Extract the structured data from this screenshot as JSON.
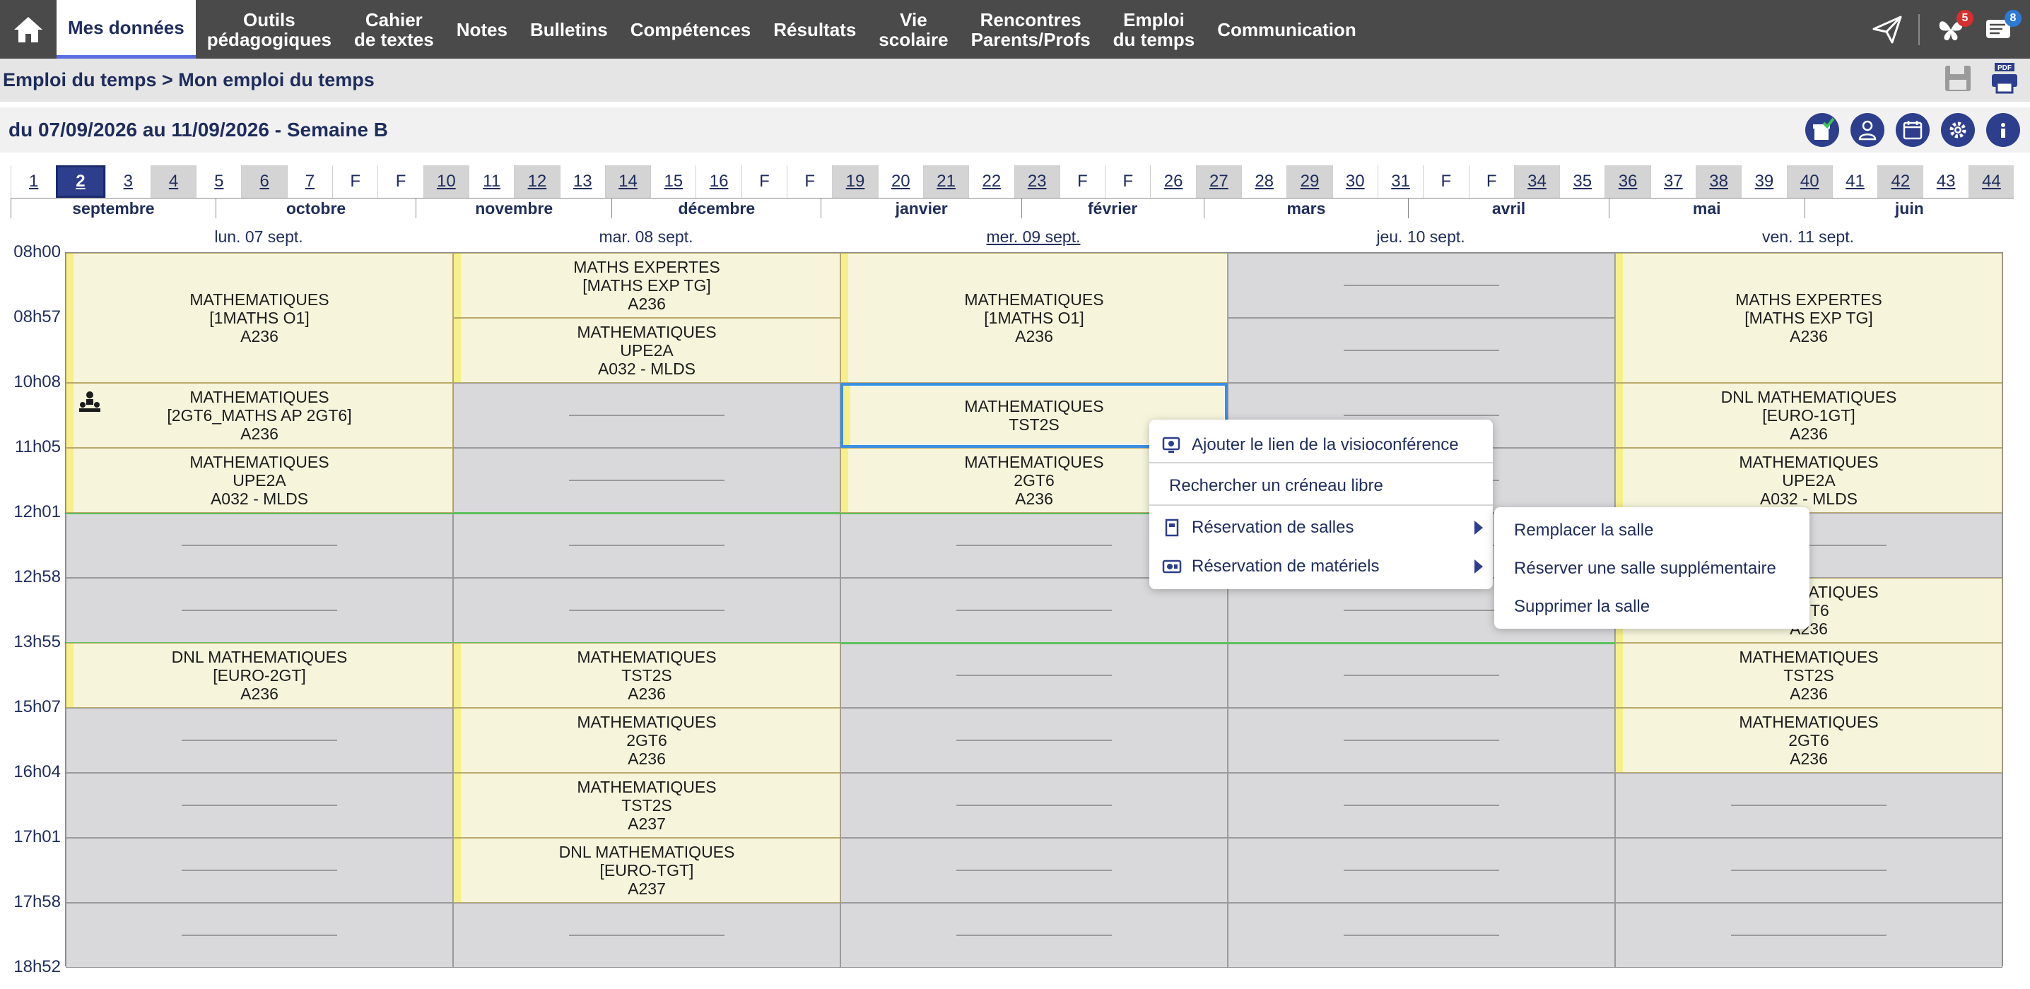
{
  "nav": {
    "items": [
      {
        "label": "Mes données",
        "active": true
      },
      {
        "label": "Outils\npédagogiques"
      },
      {
        "label": "Cahier\nde textes"
      },
      {
        "label": "Notes"
      },
      {
        "label": "Bulletins"
      },
      {
        "label": "Compétences"
      },
      {
        "label": "Résultats"
      },
      {
        "label": "Vie\nscolaire"
      },
      {
        "label": "Rencontres\nParents/Profs"
      },
      {
        "label": "Emploi\ndu temps"
      },
      {
        "label": "Communication"
      }
    ],
    "notif_count": "5",
    "msg_count": "8"
  },
  "breadcrumb": "Emploi du temps > Mon emploi du temps",
  "week_title": "du 07/09/2026 au 11/09/2026 - Semaine B",
  "weeks": [
    {
      "l": "1",
      "g": false
    },
    {
      "l": "2",
      "g": false,
      "sel": true
    },
    {
      "l": "3",
      "g": false
    },
    {
      "l": "4",
      "g": true
    },
    {
      "l": "5",
      "g": false
    },
    {
      "l": "6",
      "g": true
    },
    {
      "l": "7",
      "g": false
    },
    {
      "l": "F",
      "g": false,
      "h": true
    },
    {
      "l": "F",
      "g": false,
      "h": true
    },
    {
      "l": "10",
      "g": true
    },
    {
      "l": "11",
      "g": false
    },
    {
      "l": "12",
      "g": true
    },
    {
      "l": "13",
      "g": false
    },
    {
      "l": "14",
      "g": true
    },
    {
      "l": "15",
      "g": false
    },
    {
      "l": "16",
      "g": false
    },
    {
      "l": "F",
      "g": false,
      "h": true
    },
    {
      "l": "F",
      "g": false,
      "h": true
    },
    {
      "l": "19",
      "g": true
    },
    {
      "l": "20",
      "g": false
    },
    {
      "l": "21",
      "g": true
    },
    {
      "l": "22",
      "g": false
    },
    {
      "l": "23",
      "g": true
    },
    {
      "l": "F",
      "g": false,
      "h": true
    },
    {
      "l": "F",
      "g": false,
      "h": true
    },
    {
      "l": "26",
      "g": false
    },
    {
      "l": "27",
      "g": true
    },
    {
      "l": "28",
      "g": false
    },
    {
      "l": "29",
      "g": true
    },
    {
      "l": "30",
      "g": false
    },
    {
      "l": "31",
      "g": false
    },
    {
      "l": "F",
      "g": false,
      "h": true
    },
    {
      "l": "F",
      "g": false,
      "h": true
    },
    {
      "l": "34",
      "g": true
    },
    {
      "l": "35",
      "g": false
    },
    {
      "l": "36",
      "g": true
    },
    {
      "l": "37",
      "g": false
    },
    {
      "l": "38",
      "g": true
    },
    {
      "l": "39",
      "g": false
    },
    {
      "l": "40",
      "g": true
    },
    {
      "l": "41",
      "g": false
    },
    {
      "l": "42",
      "g": true
    },
    {
      "l": "43",
      "g": false
    },
    {
      "l": "44",
      "g": true
    }
  ],
  "months": [
    {
      "label": "septembre",
      "start": 0,
      "span": 4.5
    },
    {
      "label": "octobre",
      "start": 4.5,
      "span": 4.4
    },
    {
      "label": "novembre",
      "start": 8.9,
      "span": 4.3
    },
    {
      "label": "décembre",
      "start": 13.2,
      "span": 4.6
    },
    {
      "label": "janvier",
      "start": 17.8,
      "span": 4.4
    },
    {
      "label": "février",
      "start": 22.2,
      "span": 4
    },
    {
      "label": "mars",
      "start": 26.2,
      "span": 4.5
    },
    {
      "label": "avril",
      "start": 30.7,
      "span": 4.4
    },
    {
      "label": "mai",
      "start": 35.1,
      "span": 4.3
    },
    {
      "label": "juin",
      "start": 39.4,
      "span": 4.6
    }
  ],
  "times": [
    "08h00",
    "08h57",
    "10h08",
    "11h05",
    "12h01",
    "12h58",
    "13h55",
    "15h07",
    "16h04",
    "17h01",
    "17h58",
    "18h52"
  ],
  "days": [
    {
      "label": "lun. 07 sept."
    },
    {
      "label": "mar. 08 sept."
    },
    {
      "label": "mer. 09 sept.",
      "today": true
    },
    {
      "label": "jeu. 10 sept."
    },
    {
      "label": "ven. 11 sept."
    }
  ],
  "courses": [
    {
      "day": 0,
      "start": 0,
      "len": 2,
      "lines": [
        "MATHEMATIQUES",
        "[1MATHS O1]",
        "A236"
      ]
    },
    {
      "day": 0,
      "start": 2,
      "len": 1,
      "lines": [
        "MATHEMATIQUES",
        "[2GT6_MATHS AP 2GT6]",
        "A236"
      ],
      "icon": true
    },
    {
      "day": 0,
      "start": 3,
      "len": 1,
      "lines": [
        "MATHEMATIQUES",
        "UPE2A",
        "A032 - MLDS"
      ]
    },
    {
      "day": 0,
      "start": 6,
      "len": 1,
      "lines": [
        "DNL MATHEMATIQUES",
        "[EURO-2GT]",
        "A236"
      ]
    },
    {
      "day": 1,
      "start": 0,
      "len": 1,
      "lines": [
        "MATHS EXPERTES",
        "[MATHS EXP TG]",
        "A236"
      ]
    },
    {
      "day": 1,
      "start": 1,
      "len": 1,
      "lines": [
        "MATHEMATIQUES",
        "UPE2A",
        "A032 - MLDS"
      ]
    },
    {
      "day": 1,
      "start": 6,
      "len": 1,
      "lines": [
        "MATHEMATIQUES",
        "TST2S",
        "A236"
      ]
    },
    {
      "day": 1,
      "start": 7,
      "len": 1,
      "lines": [
        "MATHEMATIQUES",
        "2GT6",
        "A236"
      ]
    },
    {
      "day": 1,
      "start": 8,
      "len": 1,
      "lines": [
        "MATHEMATIQUES",
        "TST2S",
        "A237"
      ]
    },
    {
      "day": 1,
      "start": 9,
      "len": 1,
      "lines": [
        "DNL MATHEMATIQUES",
        "[EURO-TGT]",
        "A237"
      ]
    },
    {
      "day": 2,
      "start": 0,
      "len": 2,
      "lines": [
        "MATHEMATIQUES",
        "[1MATHS O1]",
        "A236"
      ]
    },
    {
      "day": 2,
      "start": 2,
      "len": 1,
      "lines": [
        "MATHEMATIQUES",
        "TST2S"
      ],
      "sel": true
    },
    {
      "day": 2,
      "start": 3,
      "len": 1,
      "lines": [
        "MATHEMATIQUES",
        "2GT6",
        "A236"
      ]
    },
    {
      "day": 4,
      "start": 0,
      "len": 2,
      "lines": [
        "MATHS EXPERTES",
        "[MATHS EXP TG]",
        "A236"
      ]
    },
    {
      "day": 4,
      "start": 2,
      "len": 1,
      "lines": [
        "DNL MATHEMATIQUES",
        "[EURO-1GT]",
        "A236"
      ]
    },
    {
      "day": 4,
      "start": 3,
      "len": 1,
      "lines": [
        "MATHEMATIQUES",
        "UPE2A",
        "A032 - MLDS"
      ]
    },
    {
      "day": 4,
      "start": 5,
      "len": 1,
      "lines": [
        "MATHEMATIQUES",
        "2GT6",
        "A236"
      ]
    },
    {
      "day": 4,
      "start": 6,
      "len": 1,
      "lines": [
        "MATHEMATIQUES",
        "TST2S",
        "A236"
      ]
    },
    {
      "day": 4,
      "start": 7,
      "len": 1,
      "lines": [
        "MATHEMATIQUES",
        "2GT6",
        "A236"
      ]
    }
  ],
  "context_menu": {
    "item1": "Ajouter le lien de la visioconférence",
    "item2": "Rechercher un créneau libre",
    "item3": "Réservation de salles",
    "item4": "Réservation de matériels"
  },
  "submenu": {
    "item1": "Remplacer la salle",
    "item2": "Réserver une salle supplémentaire",
    "item3": "Supprimer la salle"
  }
}
